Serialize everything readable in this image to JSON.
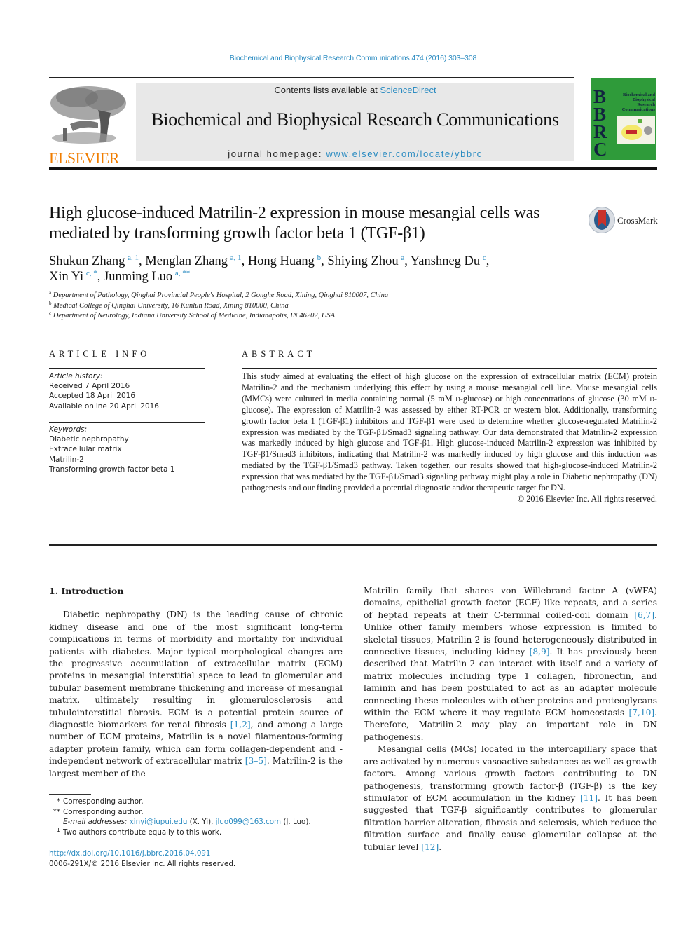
{
  "header": {
    "citation": "Biochemical and Biophysical Research Communications 474 (2016) 303–308",
    "contents_prefix": "Contents lists available at ",
    "contents_link": "ScienceDirect",
    "journal_name": "Biochemical and Biophysical Research Communications",
    "homepage_prefix": "journal homepage: ",
    "homepage_link": "www.elsevier.com/locate/ybbrc",
    "publisher_logo_text": "ELSEVIER",
    "cover": {
      "letters": [
        "B",
        "B",
        "R",
        "C"
      ],
      "title": "Biochemical and Biophysical Research Communications"
    }
  },
  "article": {
    "title": "High glucose-induced Matrilin-2 expression in mouse mesangial cells was mediated by transforming growth factor beta 1 (TGF-β1)",
    "crossmark_label": "CrossMark",
    "authors": [
      {
        "name": "Shukun Zhang",
        "sup": "a, 1",
        "sep": ", "
      },
      {
        "name": "Menglan Zhang",
        "sup": "a, 1",
        "sep": ", "
      },
      {
        "name": "Hong Huang",
        "sup": "b",
        "sep": ", "
      },
      {
        "name": "Shiying Zhou",
        "sup": "a",
        "sep": ", "
      },
      {
        "name": "Yanshneg Du",
        "sup": "c",
        "sep": ","
      },
      {
        "name": "Xin Yi",
        "sup": "c, *",
        "sep": ", "
      },
      {
        "name": "Junming Luo",
        "sup": "a, **",
        "sep": ""
      }
    ],
    "affiliations": [
      {
        "key": "a",
        "text": "Department of Pathology, Qinghai Provincial People's Hospital, 2 Gonghe Road, Xining, Qinghai 810007, China"
      },
      {
        "key": "b",
        "text": "Medical College of Qinghai University, 16 Kunlun Road, Xining 810000, China"
      },
      {
        "key": "c",
        "text": "Department of Neurology, Indiana University School of Medicine, Indianapolis, IN 46202, USA"
      }
    ]
  },
  "article_info": {
    "heading": "ARTICLE INFO",
    "history_label": "Article history:",
    "history": [
      "Received 7 April 2016",
      "Accepted 18 April 2016",
      "Available online 20 April 2016"
    ],
    "keywords_label": "Keywords:",
    "keywords": [
      "Diabetic nephropathy",
      "Extracellular matrix",
      "Matrilin-2",
      "Transforming growth factor beta 1"
    ]
  },
  "abstract": {
    "heading": "ABSTRACT",
    "text_1": "This study aimed at evaluating the effect of high glucose on the expression of extracellular matrix (ECM) protein Matrilin-2 and the mechanism underlying this effect by using a mouse mesangial cell line. Mouse mesangial cells (MMCs) were cultured in media containing normal (5 mM ",
    "d1": "d",
    "text_2": "-glucose) or high concentrations of glucose (30 mM ",
    "d2": "d",
    "text_3": "-glucose). The expression of Matrilin-2 was assessed by either RT-PCR or western blot. Additionally, transforming growth factor beta 1 (TGF-β1) inhibitors and TGF-β1 were used to determine whether glucose-regulated Matrilin-2 expression was mediated by the TGF-β1/Smad3 signaling pathway. Our data demonstrated that Matrilin-2 expression was markedly induced by high glucose and TGF-β1. High glucose-induced Matrilin-2 expression was inhibited by TGF-β1/Smad3 inhibitors, indicating that Matrilin-2 was markedly induced by high glucose and this induction was mediated by the TGF-β1/Smad3 pathway. Taken together, our results showed that high-glucose-induced Matrilin-2 expression that was mediated by the TGF-β1/Smad3 signaling pathway might play a role in Diabetic nephropathy (DN) pathogenesis and our finding provided a potential diagnostic and/or therapeutic target for DN.",
    "copyright": "© 2016 Elsevier Inc. All rights reserved."
  },
  "introduction": {
    "heading": "1.  Introduction",
    "p1_a": "Diabetic nephropathy (DN) is the leading cause of chronic kidney disease and one of the most significant long-term complications in terms of morbidity and mortality for individual patients with diabetes. Major typical morphological changes are the progressive accumulation of extracellular matrix (ECM) proteins in mesangial interstitial space to lead to glomerular and tubular basement membrane thickening and increase of mesangial matrix, ultimately resulting in glomerulosclerosis and tubulointerstitial fibrosis. ECM is a potential protein source of diagnostic biomarkers for renal fibrosis ",
    "ref_1": "[1,2]",
    "p1_b": ", and among a large number of ECM proteins, Matrilin is a novel filamentous-forming adapter protein family, which can form collagen-dependent and -independent network of extracellular matrix ",
    "ref_2": "[3–5]",
    "p1_c": ". Matrilin-2 is the largest member of the Matrilin family that shares von Willebrand factor A (vWFA) domains, epithelial growth factor (EGF) like repeats, and a series of heptad repeats at their C-terminal coiled-coil domain ",
    "ref_3": "[6,7]",
    "p1_d": ". Unlike other family members whose expression is limited to skeletal tissues, Matrilin-2 is found heterogeneously distributed in connective tissues, including kidney ",
    "ref_4": "[8,9]",
    "p1_e": ". It has previously been described that Matrilin-2 can interact with itself and a variety of matrix molecules including type 1 collagen, fibronectin, and laminin and has been postulated to act as an adapter molecule connecting these molecules with other proteins and proteoglycans within the ECM where it may regulate ECM homeostasis ",
    "ref_5": "[7,10]",
    "p1_f": ". Therefore, Matrilin-2 may play an important role in DN pathogenesis.",
    "p2_a": "Mesangial cells (MCs) located in the intercapillary space that are activated by numerous vasoactive substances as well as growth factors. Among various growth factors contributing to DN pathogenesis, transforming growth factor-β (TGF-β) is the key stimulator of ECM accumulation in the kidney ",
    "ref_6": "[11]",
    "p2_b": ". It has been suggested that TGF-β significantly contributes to glomerular filtration barrier alteration, fibrosis and sclerosis, which reduce the filtration surface and finally cause glomerular collapse at the tubular level ",
    "ref_7": "[12]",
    "p2_c": "."
  },
  "footnotes": {
    "fn1_mark": "*",
    "fn1_text": "Corresponding author.",
    "fn2_mark": "**",
    "fn2_text": "Corresponding author.",
    "email_label": "E-mail addresses:",
    "email_1": "xinyi@iupui.edu",
    "email_1_owner": " (X. Yi), ",
    "email_2": "jluo099@163.com",
    "email_2_owner": " (J. Luo).",
    "fn3_mark": "1",
    "fn3_text": "Two authors contribute equally to this work.",
    "doi_link": "http://dx.doi.org/10.1016/j.bbrc.2016.04.091",
    "issn_line": "0006-291X/© 2016 Elsevier Inc. All rights reserved."
  },
  "colors": {
    "link": "#2a8bc1",
    "elsevier_orange": "#f07d00",
    "cover_green": "#2f9b3a",
    "masthead_gray": "#e8e8e8"
  }
}
